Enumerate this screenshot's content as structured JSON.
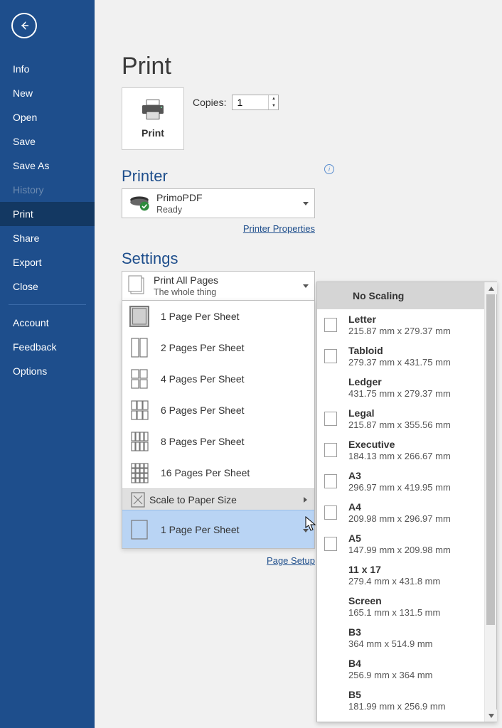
{
  "sidebar": {
    "items": [
      {
        "label": "Info"
      },
      {
        "label": "New"
      },
      {
        "label": "Open"
      },
      {
        "label": "Save"
      },
      {
        "label": "Save As"
      },
      {
        "label": "History"
      },
      {
        "label": "Print"
      },
      {
        "label": "Share"
      },
      {
        "label": "Export"
      },
      {
        "label": "Close"
      }
    ],
    "items2": [
      {
        "label": "Account"
      },
      {
        "label": "Feedback"
      },
      {
        "label": "Options"
      }
    ]
  },
  "page": {
    "title": "Print",
    "print_button": "Print",
    "copies_label": "Copies:",
    "copies_value": "1"
  },
  "printer": {
    "section_title": "Printer",
    "name": "PrimoPDF",
    "status": "Ready",
    "properties_link": "Printer Properties"
  },
  "settings": {
    "section_title": "Settings",
    "print_pages_line1": "Print All Pages",
    "print_pages_line2": "The whole thing",
    "page_setup_link": "Page Setup"
  },
  "sheet_menu": {
    "items": [
      "1 Page Per Sheet",
      "2 Pages Per Sheet",
      "4 Pages Per Sheet",
      "6 Pages Per Sheet",
      "8 Pages Per Sheet",
      "16 Pages Per Sheet"
    ],
    "scale_label": "Scale to Paper Size",
    "current": "1 Page Per Sheet"
  },
  "paper_menu": {
    "header": "No Scaling",
    "items": [
      {
        "name": "Letter",
        "dim": "215.87 mm x 279.37 mm",
        "check": true
      },
      {
        "name": "Tabloid",
        "dim": "279.37 mm x 431.75 mm",
        "check": true
      },
      {
        "name": "Ledger",
        "dim": "431.75 mm x 279.37 mm",
        "check": false
      },
      {
        "name": "Legal",
        "dim": "215.87 mm x 355.56 mm",
        "check": true
      },
      {
        "name": "Executive",
        "dim": "184.13 mm x 266.67 mm",
        "check": true
      },
      {
        "name": "A3",
        "dim": "296.97 mm x 419.95 mm",
        "check": true
      },
      {
        "name": "A4",
        "dim": "209.98 mm x 296.97 mm",
        "check": true
      },
      {
        "name": "A5",
        "dim": "147.99 mm x 209.98 mm",
        "check": true
      },
      {
        "name": "11 x 17",
        "dim": "279.4 mm x 431.8 mm",
        "check": false
      },
      {
        "name": "Screen",
        "dim": "165.1 mm x 131.5 mm",
        "check": false
      },
      {
        "name": "B3",
        "dim": "364 mm x 514.9 mm",
        "check": false
      },
      {
        "name": "B4",
        "dim": "256.9 mm x 364 mm",
        "check": false
      },
      {
        "name": "B5",
        "dim": "181.99 mm x 256.9 mm",
        "check": false
      }
    ]
  }
}
